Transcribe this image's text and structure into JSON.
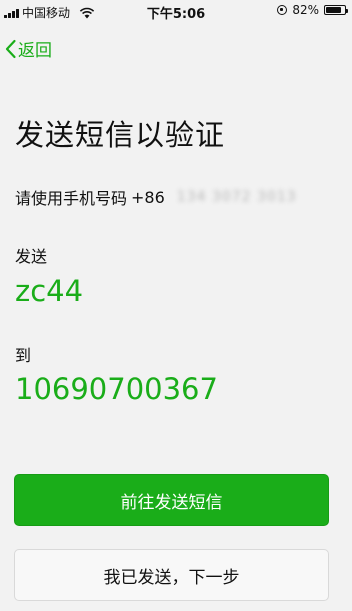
{
  "status_bar": {
    "carrier": "中国移动",
    "time": "下午5:06",
    "battery": "82%",
    "battery_level": 0.82
  },
  "nav": {
    "back_label": "返回"
  },
  "main": {
    "title": "发送短信以验证",
    "phone_label": "请使用手机号码",
    "country_code": "+86",
    "masked_number": "134 3072 3013",
    "send_label": "发送",
    "code": "zc44",
    "to_label": "到",
    "recipient_number": "10690700367"
  },
  "actions": {
    "primary_label": "前往发送短信",
    "secondary_label": "我已发送，下一步"
  },
  "colors": {
    "accent": "#1aad19",
    "background": "#f2f2f2"
  }
}
